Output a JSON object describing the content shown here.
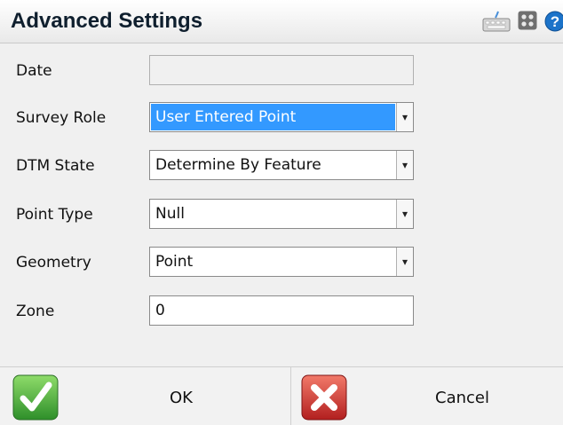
{
  "header": {
    "title": "Advanced Settings",
    "icons": [
      "keyboard-icon",
      "grid-icon",
      "help-icon"
    ]
  },
  "fields": {
    "date": {
      "label": "Date",
      "value": ""
    },
    "survey_role": {
      "label": "Survey Role",
      "value": "User Entered Point"
    },
    "dtm_state": {
      "label": "DTM State",
      "value": "Determine By Feature"
    },
    "point_type": {
      "label": "Point Type",
      "value": "Null"
    },
    "geometry": {
      "label": "Geometry",
      "value": "Point"
    },
    "zone": {
      "label": "Zone",
      "value": "0"
    }
  },
  "footer": {
    "ok_label": "OK",
    "cancel_label": "Cancel"
  },
  "colors": {
    "selection": "#3399ff",
    "ok_icon": "#3aa13a",
    "cancel_icon": "#d42a2a",
    "help_icon": "#1c73c9"
  }
}
